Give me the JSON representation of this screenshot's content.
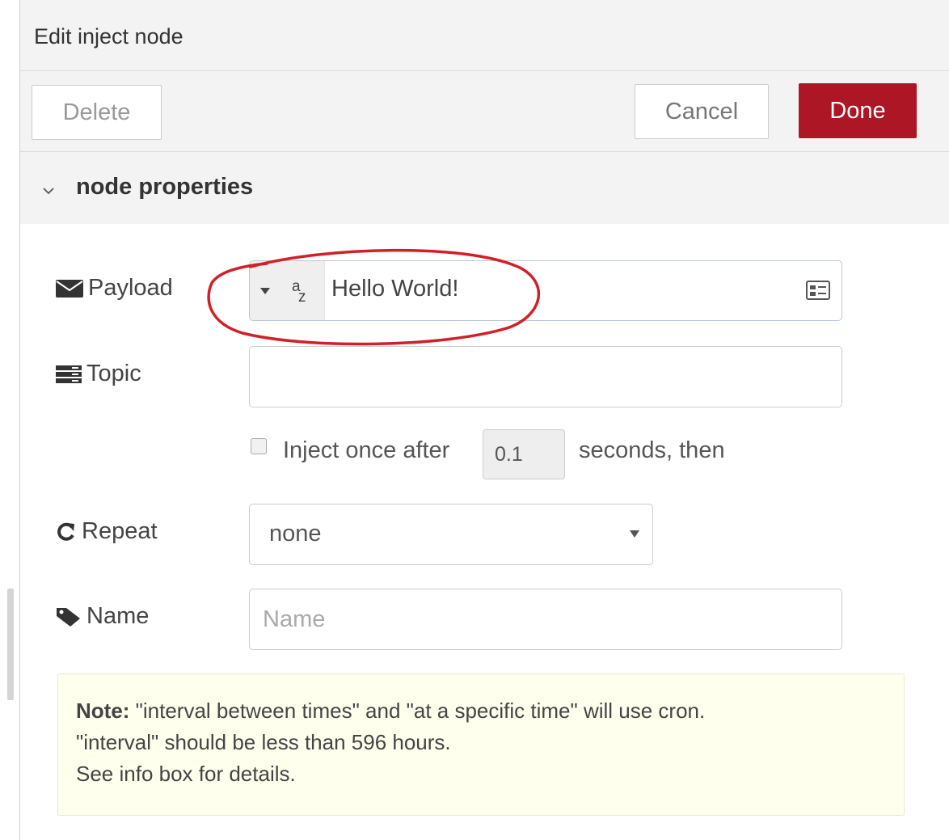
{
  "tray": {
    "title": "Edit inject node",
    "delete_label": "Delete",
    "cancel_label": "Cancel",
    "done_label": "Done",
    "section_title": "node properties"
  },
  "form": {
    "payload": {
      "label": "Payload",
      "type_icon": "az-string-icon",
      "type_letter_top": "a",
      "type_letter_bottom": "z",
      "value": "Hello World!"
    },
    "topic": {
      "label": "Topic",
      "value": ""
    },
    "inject_once": {
      "checked": false,
      "before_text": "Inject once after",
      "delay": "0.1",
      "after_text": "seconds, then"
    },
    "repeat": {
      "label": "Repeat",
      "value": "none"
    },
    "name": {
      "label": "Name",
      "placeholder": "Name",
      "value": ""
    }
  },
  "note": {
    "bold": "Note:",
    "line1": " \"interval between times\" and \"at a specific time\" will use cron.",
    "line2": "\"interval\" should be less than 596 hours.",
    "line3": "See info box for details."
  },
  "colors": {
    "done_button": "#ad1625",
    "annotation": "#d21f28",
    "note_background": "#ffffee",
    "header_background": "#f3f3f3"
  }
}
